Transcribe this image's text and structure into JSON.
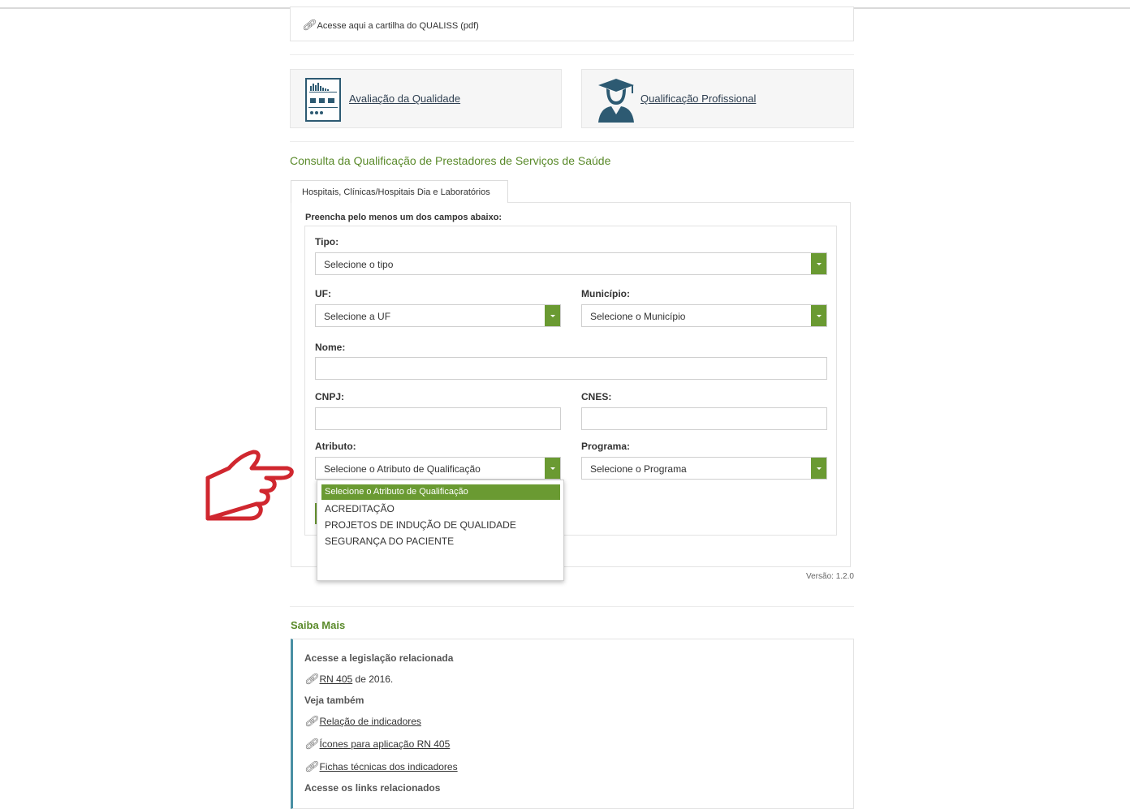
{
  "cartilha_link": "Acesse aqui a cartilha do QUALISS (pdf)",
  "cards": {
    "avaliacao": "Avaliação da Qualidade",
    "qualificacao": "Qualificação Profissional"
  },
  "consulta_title": "Consulta da Qualificação de Prestadores de Serviços de Saúde",
  "tab_label": "Hospitais, Clínicas/Hospitais Dia e Laboratórios",
  "form": {
    "instruction": "Preencha pelo menos um dos campos abaixo:",
    "tipo_label": "Tipo:",
    "tipo_value": "Selecione o tipo",
    "uf_label": "UF:",
    "uf_value": "Selecione a UF",
    "municipio_label": "Município:",
    "municipio_value": "Selecione o Município",
    "nome_label": "Nome:",
    "cnpj_label": "CNPJ:",
    "cnes_label": "CNES:",
    "atributo_label": "Atributo:",
    "atributo_value": "Selecione o Atributo de Qualificação",
    "programa_label": "Programa:",
    "programa_value": "Selecione o Programa"
  },
  "dropdown_options": [
    "Selecione o Atributo de Qualificação",
    "ACREDITAÇÃO",
    "PROJETOS DE INDUÇÃO DE QUALIDADE",
    "SEGURANÇA DO PACIENTE"
  ],
  "versao": "Versão: 1.2.0",
  "saiba_title": "Saiba Mais",
  "saiba": {
    "legislacao_head": "Acesse a legislação relacionada",
    "rn_link": "RN 405",
    "rn_suffix": " de 2016.",
    "veja_head": "Veja também",
    "links": [
      "Relação de indicadores",
      "Ícones para aplicação RN 405",
      "Fichas técnicas dos indicadores"
    ],
    "links_head": "Acesse os links relacionados"
  },
  "colors": {
    "accent_green": "#6a9a32",
    "title_green": "#5a8a2a",
    "pointer_red": "#d0272f"
  }
}
